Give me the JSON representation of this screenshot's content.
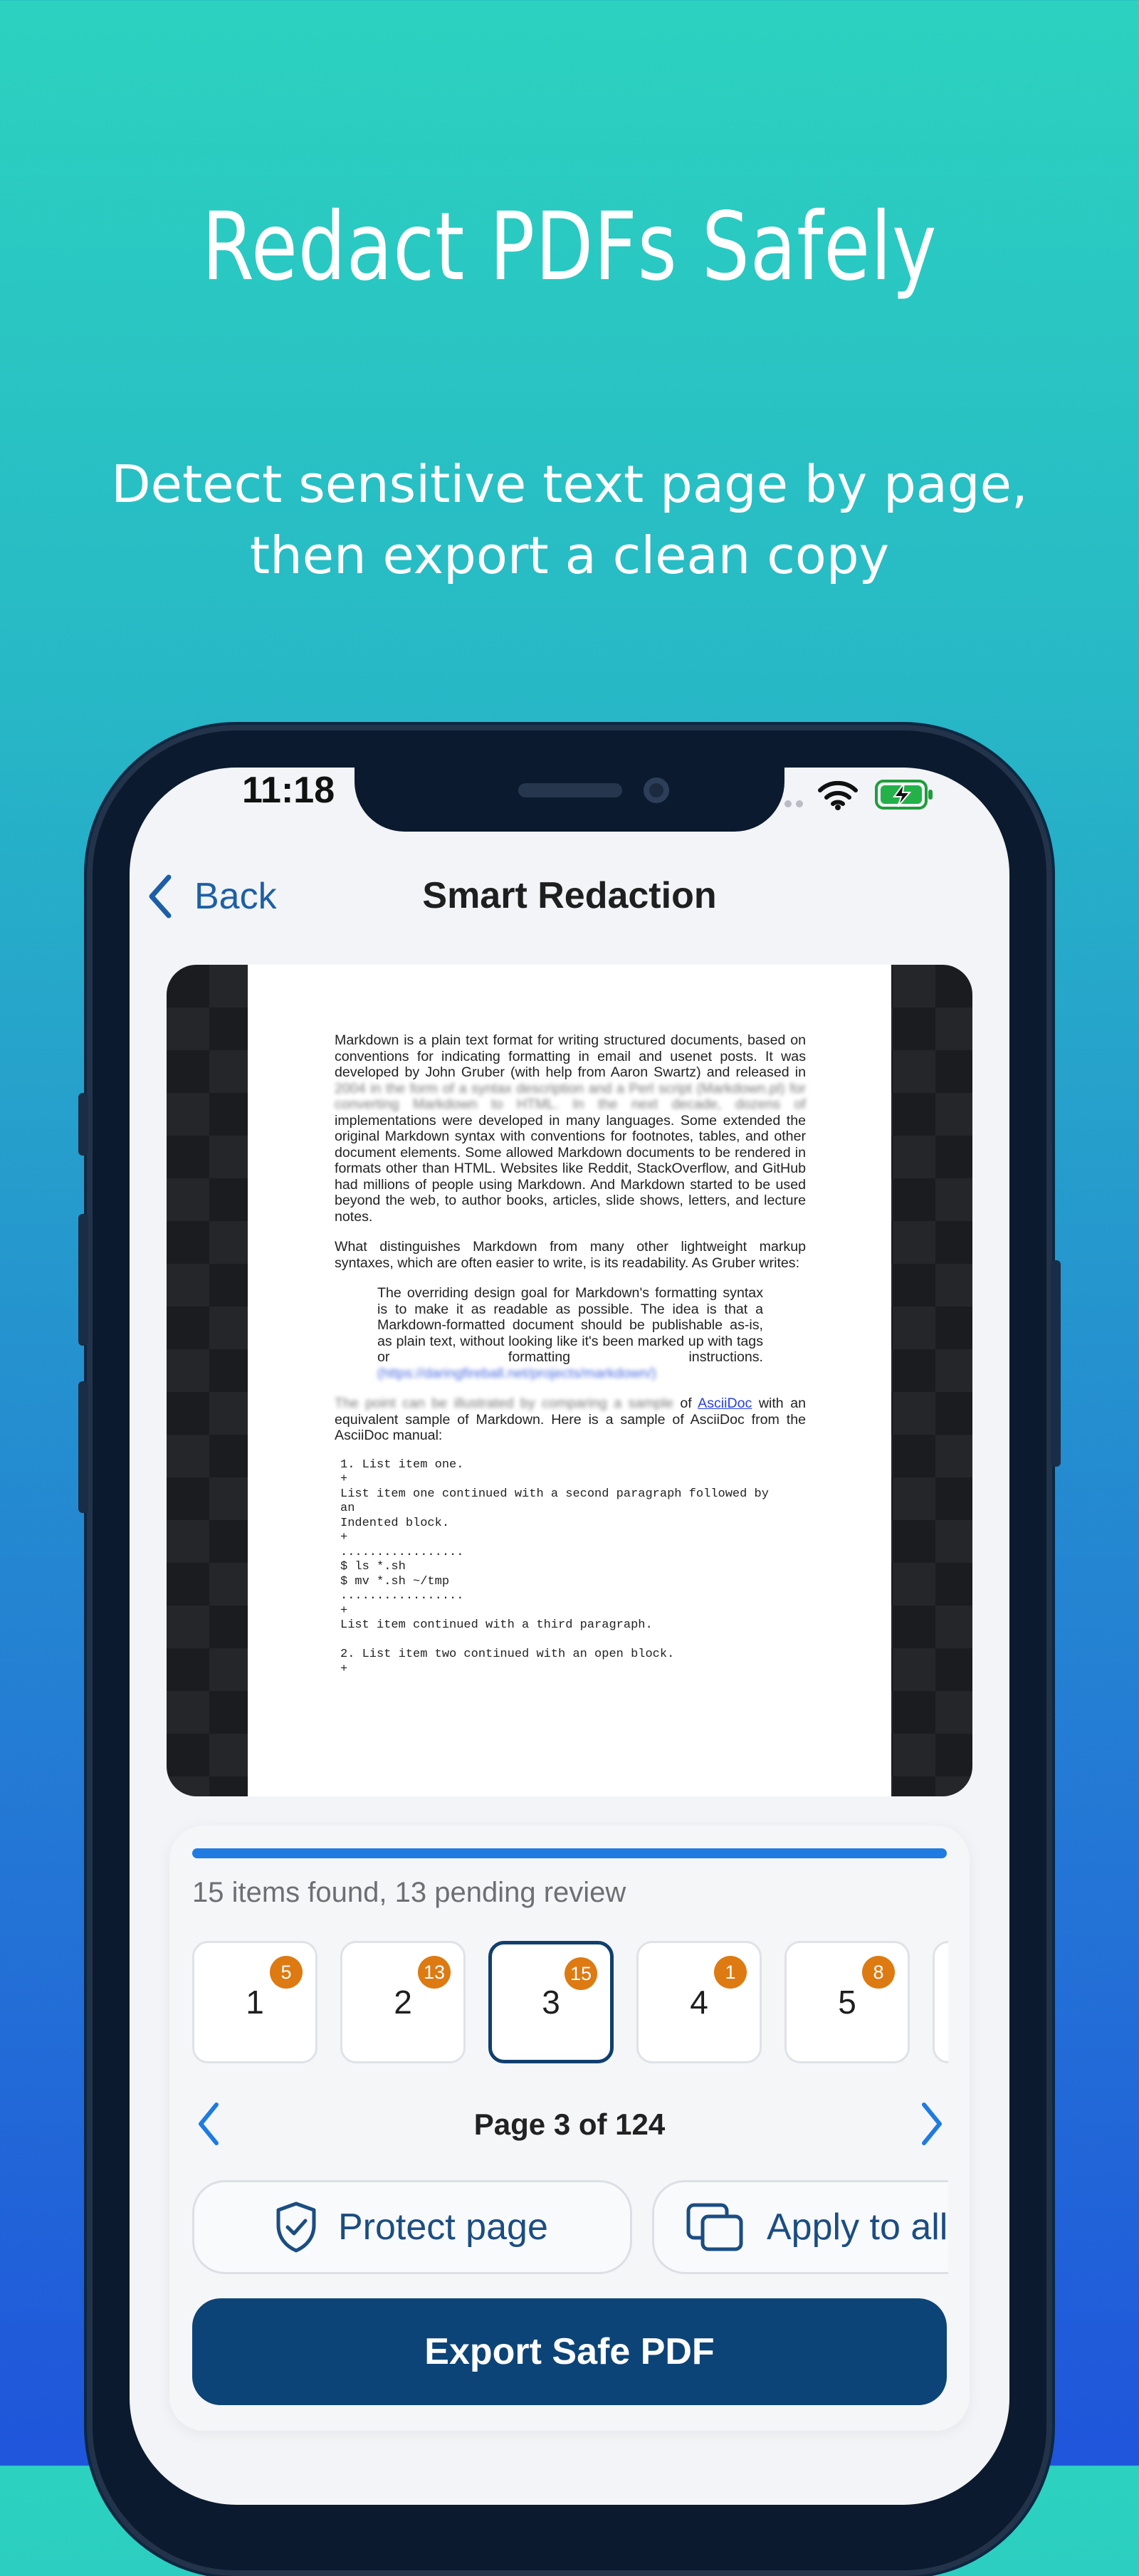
{
  "hero": {
    "title": "Redact PDFs Safely",
    "subtitle_line1": "Detect sensitive text page by page,",
    "subtitle_line2": "then export a clean copy"
  },
  "status_bar": {
    "time": "11:18",
    "icons": [
      "wifi-icon",
      "battery-charging-icon"
    ]
  },
  "nav": {
    "back_label": "Back",
    "title": "Smart Redaction"
  },
  "document": {
    "p1": "Markdown is a plain text format for writing structured documents, based on conventions for indicating formatting in email and usenet posts. It was developed by John Gruber (with help from Aaron Swartz) and released in",
    "p1_redacted": "2004 in the form of a syntax description and a Perl script (Markdown.pl) for converting Markdown to HTML. In the next decade, dozens of",
    "p1_rest": "implementations were developed in many languages. Some extended the original Markdown syntax with conventions for footnotes, tables, and other document elements. Some allowed Markdown documents to be rendered in formats other than HTML. Websites like Reddit, StackOverflow, and GitHub had millions of people using Markdown. And Markdown started to be used beyond the web, to author books, articles, slide shows, letters, and lecture notes.",
    "p2": "What distinguishes Markdown from many other lightweight markup syntaxes, which are often easier to write, is its readability. As Gruber writes:",
    "quote": "The overriding design goal for Markdown's formatting syntax is to make it as readable as possible. The idea is that a Markdown-formatted document should be publishable as-is, as plain text, without looking like it's been marked up with tags or formatting instructions.",
    "quote_link_redacted": "(https://daringfireball.net/projects/markdown/)",
    "p3_redacted": "The point can be illustrated by comparing a sample",
    "p3_mid": " of ",
    "p3_link": "AsciiDoc",
    "p3_rest": " with an equivalent sample of Markdown. Here is a sample of AsciiDoc from the AsciiDoc manual:",
    "code": "1. List item one.\n+\nList item one continued with a second paragraph followed by\nan\nIndented block.\n+\n.................\n$ ls *.sh\n$ mv *.sh ~/tmp\n.................\n+\nList item continued with a third paragraph.\n\n2. List item two continued with an open block.\n+"
  },
  "review": {
    "progress": 1.0,
    "summary": "15 items found, 13 pending review",
    "pages": [
      {
        "number": "1",
        "count": "5",
        "selected": false
      },
      {
        "number": "2",
        "count": "13",
        "selected": false
      },
      {
        "number": "3",
        "count": "15",
        "selected": true
      },
      {
        "number": "4",
        "count": "1",
        "selected": false
      },
      {
        "number": "5",
        "count": "8",
        "selected": false
      }
    ],
    "page_indicator": "Page 3 of 124"
  },
  "actions": {
    "protect_label": "Protect page",
    "apply_label": "Apply to all"
  },
  "export_label": "Export Safe PDF",
  "colors": {
    "accent": "#1f7be2",
    "primary_button": "#0c4478",
    "badge": "#dd7a12",
    "link": "#1d5fa6"
  }
}
